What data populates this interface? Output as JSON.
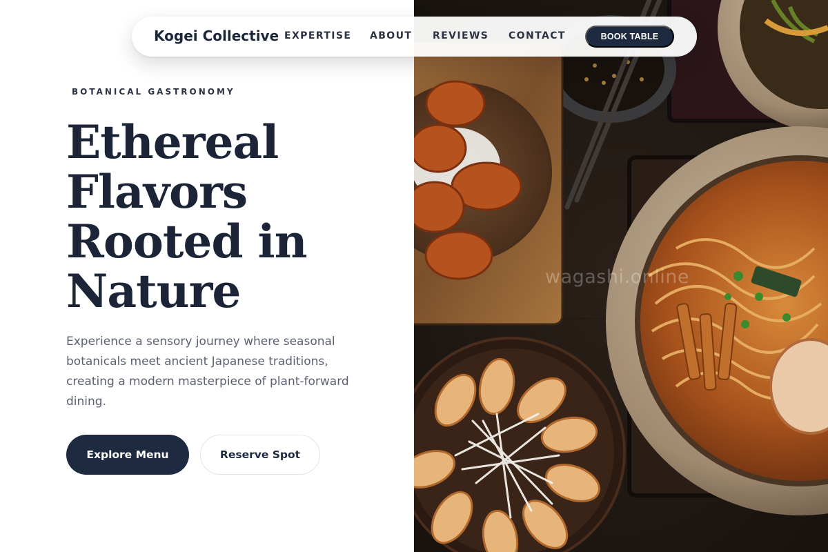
{
  "nav": {
    "brand": "Kogei Collective",
    "links": [
      "EXPERTISE",
      "ABOUT",
      "REVIEWS",
      "CONTACT"
    ],
    "cta_label": "BOOK TABLE"
  },
  "hero": {
    "eyebrow": "BOTANICAL GASTRONOMY",
    "headline_lines": [
      "Ethereal",
      "Flavors",
      "Rooted in",
      "Nature"
    ],
    "description": "Experience a sensory journey where seasonal botanicals meet ancient Japanese traditions, creating a modern masterpiece of plant-forward dining.",
    "primary_button": "Explore Menu",
    "secondary_button": "Reserve Spot"
  },
  "photo": {
    "watermark": "wagashi.online",
    "subject": "overhead japanese food spread"
  },
  "colors": {
    "navy": "#1d2a3f",
    "text": "#1c2538",
    "muted": "#5b6170",
    "background": "#ffffff"
  }
}
